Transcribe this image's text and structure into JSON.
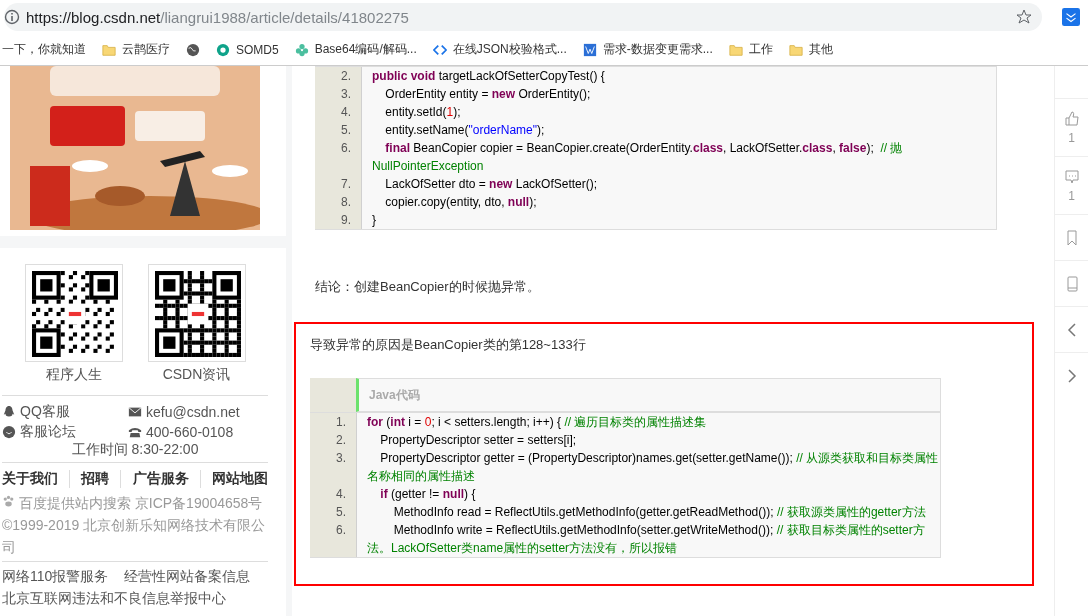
{
  "browser": {
    "url_host": "https://blog.csdn.net",
    "url_path": "/liangrui1988/article/details/41802275",
    "bookmarks": [
      {
        "kind": "none",
        "label": "一下，你就知道"
      },
      {
        "kind": "folder",
        "label": "云鹊医疗"
      },
      {
        "kind": "globe"
      },
      {
        "kind": "shield",
        "label": "SOMD5"
      },
      {
        "kind": "flower",
        "label": "Base64编码/解码..."
      },
      {
        "kind": "code",
        "label": "在线JSON校验格式..."
      },
      {
        "kind": "app",
        "label": "需求-数据变更需求..."
      },
      {
        "kind": "folder",
        "label": "工作"
      },
      {
        "kind": "folder",
        "label": "其他"
      }
    ]
  },
  "sidebar": {
    "ad": {
      "kind": "picture"
    },
    "qr_codes": [
      {
        "caption": "程序人生"
      },
      {
        "caption": "CSDN资讯"
      }
    ],
    "contacts": [
      {
        "kind": "qq",
        "label": "QQ客服"
      },
      {
        "kind": "mail",
        "label": "kefu@csdn.net"
      },
      {
        "kind": "forum",
        "label": "客服论坛"
      },
      {
        "kind": "phone",
        "label": "400-660-0108"
      }
    ],
    "hours": "工作时间 8:30-22:00",
    "links": [
      "关于我们",
      "招聘",
      "广告服务",
      "网站地图"
    ],
    "icp": "百度提供站内搜索 京ICP备19004658号",
    "copyright": "©1999-2019 北京创新乐知网络技术有限公司",
    "footer_links": [
      "网络110报警服务",
      "经营性网站备案信息",
      "北京互联网违法和不良信息举报中心"
    ]
  },
  "article": {
    "code_block_1": {
      "lines": [
        {
          "number": "2.",
          "tokens": [
            {
              "kind": "kw",
              "text": "public void"
            },
            {
              "kind": "plain",
              "text": " targetLackOfSetterCopyTest() {"
            }
          ]
        },
        {
          "number": "3.",
          "tokens": [
            {
              "kind": "plain",
              "text": "    OrderEntity entity = "
            },
            {
              "kind": "kw",
              "text": "new"
            },
            {
              "kind": "plain",
              "text": " OrderEntity();"
            }
          ]
        },
        {
          "number": "4.",
          "tokens": [
            {
              "kind": "plain",
              "text": "    entity.setId("
            },
            {
              "kind": "num",
              "text": "1"
            },
            {
              "kind": "plain",
              "text": ");"
            }
          ]
        },
        {
          "number": "5.",
          "tokens": [
            {
              "kind": "plain",
              "text": "    entity.setName("
            },
            {
              "kind": "str",
              "text": "\"orderName\""
            },
            {
              "kind": "plain",
              "text": ");"
            }
          ]
        },
        {
          "number": "6.",
          "tokens": [
            {
              "kind": "kw",
              "text": "    final"
            },
            {
              "kind": "plain",
              "text": " BeanCopier copier = BeanCopier.create(OrderEntity."
            },
            {
              "kind": "kw",
              "text": "class"
            },
            {
              "kind": "plain",
              "text": ", LackOfSetter."
            },
            {
              "kind": "kw",
              "text": "class"
            },
            {
              "kind": "plain",
              "text": ", "
            },
            {
              "kind": "kw",
              "text": "false"
            },
            {
              "kind": "plain",
              "text": ");  "
            },
            {
              "kind": "cm",
              "text": "// 抛NullPointerException"
            }
          ]
        },
        {
          "number": "7.",
          "tokens": [
            {
              "kind": "plain",
              "text": "    LackOfSetter dto = "
            },
            {
              "kind": "kw",
              "text": "new"
            },
            {
              "kind": "plain",
              "text": " LackOfSetter();"
            }
          ]
        },
        {
          "number": "8.",
          "tokens": [
            {
              "kind": "plain",
              "text": "    copier.copy(entity, dto, "
            },
            {
              "kind": "kw",
              "text": "null"
            },
            {
              "kind": "plain",
              "text": ");"
            }
          ]
        },
        {
          "number": "9.",
          "tokens": [
            {
              "kind": "plain",
              "text": "}"
            }
          ]
        }
      ]
    },
    "conclusion": "结论：创建BeanCopier的时候抛异常。",
    "highlight": {
      "intro": "导致异常的原因是BeanCopier类的第128~133行",
      "code_block_2": {
        "title": "Java代码",
        "lines": [
          {
            "number": "1.",
            "tokens": [
              {
                "kind": "kw",
                "text": "for"
              },
              {
                "kind": "plain",
                "text": " ("
              },
              {
                "kind": "kw",
                "text": "int"
              },
              {
                "kind": "plain",
                "text": " i = "
              },
              {
                "kind": "num",
                "text": "0"
              },
              {
                "kind": "plain",
                "text": "; i < setters.length; i++) { "
              },
              {
                "kind": "cm",
                "text": "// 遍历目标类的属性描述集"
              }
            ]
          },
          {
            "number": "2.",
            "tokens": [
              {
                "kind": "plain",
                "text": "    PropertyDescriptor setter = setters[i];"
              }
            ]
          },
          {
            "number": "3.",
            "tokens": [
              {
                "kind": "plain",
                "text": "    PropertyDescriptor getter = (PropertyDescriptor)names.get(setter.getName()); "
              },
              {
                "kind": "cm",
                "text": "// 从源类获取和目标类属性名称相同的属性描述"
              }
            ]
          },
          {
            "number": "4.",
            "tokens": [
              {
                "kind": "kw",
                "text": "    if"
              },
              {
                "kind": "plain",
                "text": " (getter != "
              },
              {
                "kind": "kw",
                "text": "null"
              },
              {
                "kind": "plain",
                "text": ") {"
              }
            ]
          },
          {
            "number": "5.",
            "tokens": [
              {
                "kind": "plain",
                "text": "        MethodInfo read = ReflectUtils.getMethodInfo(getter.getReadMethod()); "
              },
              {
                "kind": "cm",
                "text": "// 获取源类属性的getter方法"
              }
            ]
          },
          {
            "number": "6.",
            "tokens": [
              {
                "kind": "plain",
                "text": "        MethodInfo write = ReflectUtils.getMethodInfo(setter.getWriteMethod()); "
              },
              {
                "kind": "cm",
                "text": "// 获取目标类属性的setter方法。LackOfSetter类name属性的setter方法没有，所以报错"
              }
            ]
          }
        ]
      }
    }
  },
  "toolbar": [
    {
      "kind": "like",
      "count": "1"
    },
    {
      "kind": "comment",
      "count": "1"
    },
    {
      "kind": "bookmark"
    },
    {
      "kind": "phone"
    },
    {
      "kind": "prev"
    },
    {
      "kind": "next"
    }
  ]
}
